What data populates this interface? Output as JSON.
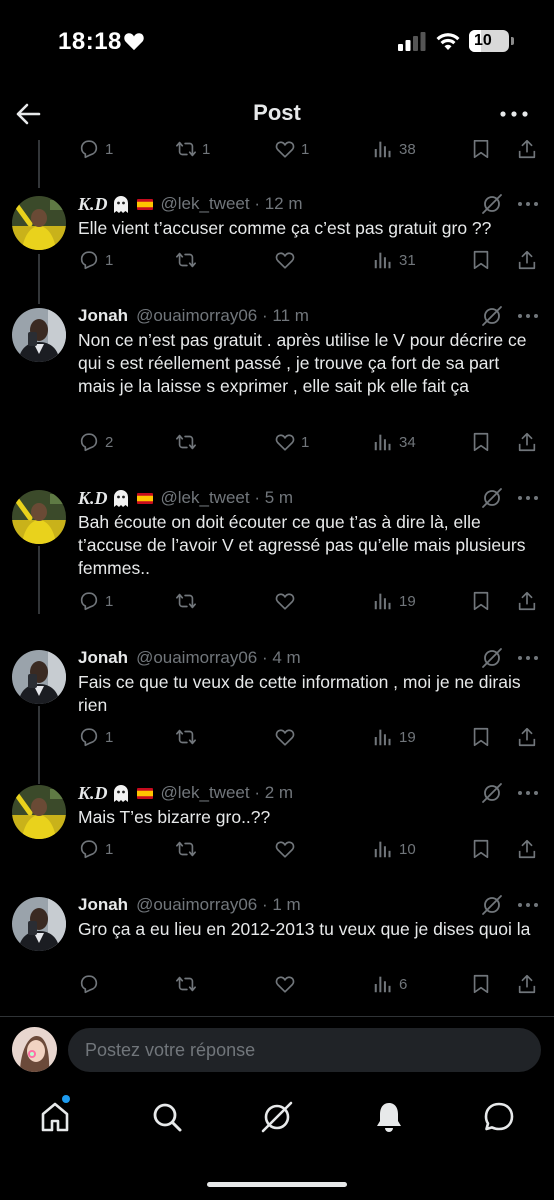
{
  "status_bar": {
    "time": "18:18",
    "battery": "10"
  },
  "header": {
    "title": "Post"
  },
  "top_actions": {
    "replies": "1",
    "reposts": "1",
    "likes": "1",
    "views": "38"
  },
  "tweets": [
    {
      "name": "K.D",
      "handle": "@lek_tweet",
      "time": "12 m",
      "text": "Elle vient t’accuser comme ça c’est pas gratuit gro ??",
      "replies": "1",
      "reposts": "",
      "likes": "",
      "views": "31"
    },
    {
      "name": "Jonah",
      "handle": "@ouaimorray06",
      "time": "11 m",
      "text": "Non ce n’est pas gratuit . après utilise le V pour décrire ce qui s est réellement passé , je trouve ça fort de sa part mais je la laisse s exprimer , elle sait pk elle fait ça",
      "replies": "2",
      "reposts": "",
      "likes": "1",
      "views": "34"
    },
    {
      "name": "K.D",
      "handle": "@lek_tweet",
      "time": "5 m",
      "text": "Bah écoute on doit écouter ce que t’as à dire là, elle t’accuse de l’avoir V et agressé pas qu’elle mais plusieurs femmes..",
      "replies": "1",
      "reposts": "",
      "likes": "",
      "views": "19"
    },
    {
      "name": "Jonah",
      "handle": "@ouaimorray06",
      "time": "4 m",
      "text": "Fais ce que tu veux de cette information , moi je ne dirais rien",
      "replies": "1",
      "reposts": "",
      "likes": "",
      "views": "19"
    },
    {
      "name": "K.D",
      "handle": "@lek_tweet",
      "time": "2 m",
      "text": "Mais T’es bizarre gro..??",
      "replies": "1",
      "reposts": "",
      "likes": "",
      "views": "10"
    },
    {
      "name": "Jonah",
      "handle": "@ouaimorray06",
      "time": "1 m",
      "text": "Gro ça a eu lieu en 2012-2013 tu veux que je dises quoi la",
      "replies": "",
      "reposts": "",
      "likes": "",
      "views": "6"
    }
  ],
  "reply_bar": {
    "placeholder": "Postez votre réponse"
  },
  "bottom_nav": [
    "home-icon",
    "search-icon",
    "grok-icon",
    "notifications-icon",
    "messages-icon"
  ],
  "colors": {
    "background": "#000000",
    "text": "#e7e9ea",
    "muted": "#71767b",
    "accent": "#1d9bf0"
  }
}
